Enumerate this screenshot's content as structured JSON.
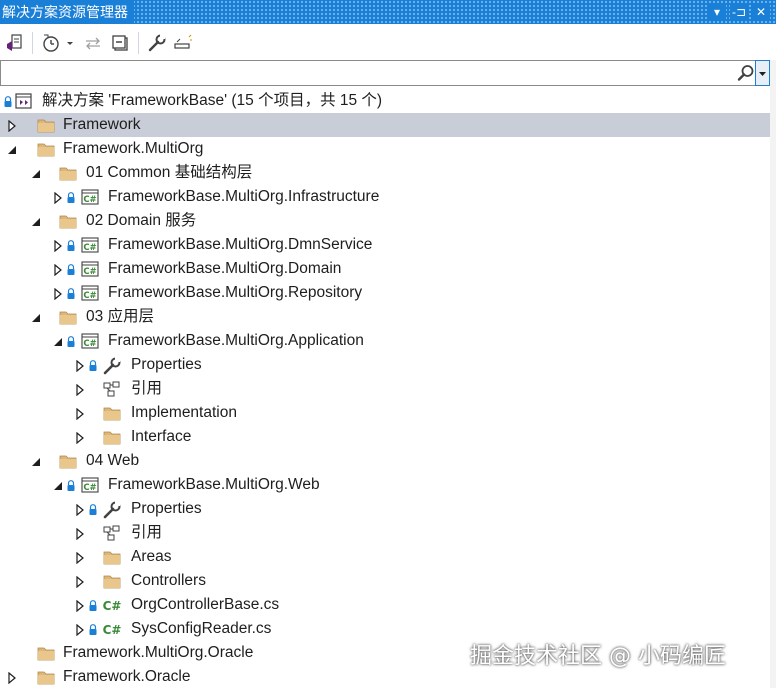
{
  "window": {
    "title": "解决方案资源管理器",
    "buttons": [
      "▾",
      "-⊐",
      "✕"
    ]
  },
  "search": {
    "value": "",
    "placeholder": ""
  },
  "solution": {
    "label": "解决方案 'FrameworkBase' (15 个项目，共 15 个)"
  },
  "tree": [
    {
      "label": "Framework",
      "icon": "folder-icon",
      "expander": "collapsed",
      "lock": false,
      "selected": true,
      "indent": 0
    },
    {
      "label": "Framework.MultiOrg",
      "icon": "folder-icon",
      "expander": "expanded",
      "lock": false,
      "indent": 0
    },
    {
      "label": "01 Common 基础结构层",
      "icon": "folder-icon",
      "expander": "expanded",
      "lock": false,
      "indent": 1
    },
    {
      "label": "FrameworkBase.MultiOrg.Infrastructure",
      "icon": "csproj-icon",
      "expander": "collapsed",
      "lock": true,
      "indent": 2
    },
    {
      "label": "02 Domain 服务",
      "icon": "folder-icon",
      "expander": "expanded",
      "lock": false,
      "indent": 1
    },
    {
      "label": "FrameworkBase.MultiOrg.DmnService",
      "icon": "csproj-icon",
      "expander": "collapsed",
      "lock": true,
      "indent": 2
    },
    {
      "label": "FrameworkBase.MultiOrg.Domain",
      "icon": "csproj-icon",
      "expander": "collapsed",
      "lock": true,
      "indent": 2
    },
    {
      "label": "FrameworkBase.MultiOrg.Repository",
      "icon": "csproj-icon",
      "expander": "collapsed",
      "lock": true,
      "indent": 2
    },
    {
      "label": "03 应用层",
      "icon": "folder-icon",
      "expander": "expanded",
      "lock": false,
      "indent": 1
    },
    {
      "label": "FrameworkBase.MultiOrg.Application",
      "icon": "csproj-icon",
      "expander": "expanded",
      "lock": true,
      "indent": 2
    },
    {
      "label": "Properties",
      "icon": "wrench-icon",
      "expander": "collapsed",
      "lock": true,
      "indent": 3
    },
    {
      "label": "引用",
      "icon": "references-icon",
      "expander": "collapsed",
      "lock": false,
      "indent": 3
    },
    {
      "label": "Implementation",
      "icon": "folder-icon",
      "expander": "collapsed",
      "lock": false,
      "indent": 3
    },
    {
      "label": "Interface",
      "icon": "folder-icon",
      "expander": "collapsed",
      "lock": false,
      "indent": 3
    },
    {
      "label": "04 Web",
      "icon": "folder-icon",
      "expander": "expanded",
      "lock": false,
      "indent": 1
    },
    {
      "label": "FrameworkBase.MultiOrg.Web",
      "icon": "csproj-icon",
      "expander": "expanded",
      "lock": true,
      "indent": 2
    },
    {
      "label": "Properties",
      "icon": "wrench-icon",
      "expander": "collapsed",
      "lock": true,
      "indent": 3
    },
    {
      "label": "引用",
      "icon": "references-icon",
      "expander": "collapsed",
      "lock": false,
      "indent": 3
    },
    {
      "label": "Areas",
      "icon": "folder-icon",
      "expander": "collapsed",
      "lock": false,
      "indent": 3
    },
    {
      "label": "Controllers",
      "icon": "folder-icon",
      "expander": "collapsed",
      "lock": false,
      "indent": 3
    },
    {
      "label": "OrgControllerBase.cs",
      "icon": "csfile-icon",
      "expander": "collapsed",
      "lock": true,
      "indent": 3
    },
    {
      "label": "SysConfigReader.cs",
      "icon": "csfile-icon",
      "expander": "collapsed",
      "lock": true,
      "indent": 3
    },
    {
      "label": "Framework.MultiOrg.Oracle",
      "icon": "folder-icon",
      "expander": "none",
      "lock": false,
      "indent": 0
    },
    {
      "label": "Framework.Oracle",
      "icon": "folder-icon",
      "expander": "collapsed",
      "lock": false,
      "indent": 0
    }
  ],
  "watermark": "掘金技术社区 @ 小码编匠",
  "colors": {
    "accent": "#1a7fd7",
    "folder": "#dcb67a",
    "csproj": "#388a34",
    "selected_row": "#c8cdd7",
    "lock": "#1a7fd7"
  }
}
